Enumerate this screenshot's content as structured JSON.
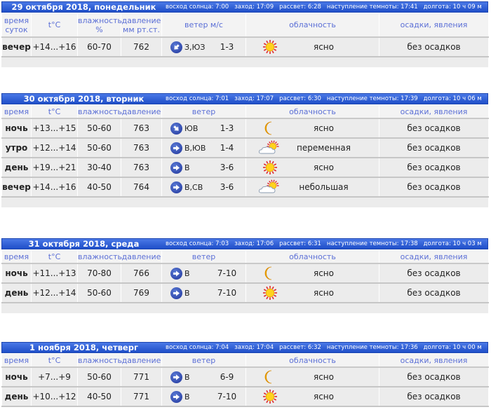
{
  "days": [
    {
      "title": "29 октября 2018, понедельник",
      "info": [
        "восход солнца: 7:00",
        "заход: 17:09",
        "рассвет: 6:28",
        "наступление темноты: 17:41",
        "долгота: 10 ч 09 м"
      ],
      "headers": {
        "time": "время суток",
        "temp": "t°C",
        "humidity": "влажность %",
        "pressure": "давление мм рт.ст.",
        "wind": "ветер м/с",
        "clouds": "облачность",
        "precip": "осадки, явления"
      },
      "rows": [
        {
          "time": "вечер",
          "temp": "+14...+16",
          "humidity": "60-70",
          "pressure": "762",
          "wind_dir": "З,ЮЗ",
          "wind_speed": "1-3",
          "wind_arrow": "sw",
          "sky_icon": "sun-icon",
          "clouds": "ясно",
          "precip": "без осадков"
        }
      ]
    },
    {
      "title": "30 октября 2018, вторник",
      "info": [
        "восход солнца: 7:01",
        "заход: 17:07",
        "рассвет: 6:30",
        "наступление темноты: 17:39",
        "долгота: 10 ч 06 м"
      ],
      "headers": {
        "time": "время",
        "temp": "t°C",
        "humidity": "влажность",
        "pressure": "давление",
        "wind": "ветер",
        "clouds": "облачность",
        "precip": "осадки, явления"
      },
      "rows": [
        {
          "time": "ночь",
          "temp": "+13...+15",
          "humidity": "50-60",
          "pressure": "763",
          "wind_dir": "ЮВ",
          "wind_speed": "1-3",
          "wind_arrow": "se",
          "sky_icon": "moon-icon",
          "clouds": "ясно",
          "precip": "без осадков"
        },
        {
          "time": "утро",
          "temp": "+12...+14",
          "humidity": "50-60",
          "pressure": "763",
          "wind_dir": "В,ЮВ",
          "wind_speed": "1-4",
          "wind_arrow": "e",
          "sky_icon": "partly-cloudy-icon",
          "clouds": "переменная",
          "precip": "без осадков"
        },
        {
          "time": "день",
          "temp": "+19...+21",
          "humidity": "30-40",
          "pressure": "763",
          "wind_dir": "В",
          "wind_speed": "3-6",
          "wind_arrow": "e",
          "sky_icon": "sun-icon",
          "clouds": "ясно",
          "precip": "без осадков"
        },
        {
          "time": "вечер",
          "temp": "+14...+16",
          "humidity": "40-50",
          "pressure": "764",
          "wind_dir": "В,СВ",
          "wind_speed": "3-6",
          "wind_arrow": "e",
          "sky_icon": "partly-cloudy-icon",
          "clouds": "небольшая",
          "precip": "без осадков"
        }
      ]
    },
    {
      "title": "31 октября 2018, среда",
      "info": [
        "восход солнца: 7:03",
        "заход: 17:06",
        "рассвет: 6:31",
        "наступление темноты: 17:38",
        "долгота: 10 ч 03 м"
      ],
      "headers": {
        "time": "время",
        "temp": "t°C",
        "humidity": "влажность",
        "pressure": "давление",
        "wind": "ветер",
        "clouds": "облачность",
        "precip": "осадки, явления"
      },
      "rows": [
        {
          "time": "ночь",
          "temp": "+11...+13",
          "humidity": "70-80",
          "pressure": "766",
          "wind_dir": "В",
          "wind_speed": "7-10",
          "wind_arrow": "e",
          "sky_icon": "moon-icon",
          "clouds": "ясно",
          "precip": "без осадков"
        },
        {
          "time": "день",
          "temp": "+12...+14",
          "humidity": "50-60",
          "pressure": "769",
          "wind_dir": "В",
          "wind_speed": "7-10",
          "wind_arrow": "e",
          "sky_icon": "sun-icon",
          "clouds": "ясно",
          "precip": "без осадков"
        }
      ]
    },
    {
      "title": "1 ноября 2018, четверг",
      "info": [
        "восход солнца: 7:04",
        "заход: 17:04",
        "рассвет: 6:32",
        "наступление темноты: 17:36",
        "долгота: 10 ч 00 м"
      ],
      "headers": {
        "time": "время",
        "temp": "t°C",
        "humidity": "влажность",
        "pressure": "давление",
        "wind": "ветер",
        "clouds": "облачность",
        "precip": "осадки, явления"
      },
      "rows": [
        {
          "time": "ночь",
          "temp": "+7...+9",
          "humidity": "50-60",
          "pressure": "771",
          "wind_dir": "В",
          "wind_speed": "6-9",
          "wind_arrow": "e",
          "sky_icon": "moon-icon",
          "clouds": "ясно",
          "precip": "без осадков"
        },
        {
          "time": "день",
          "temp": "+10...+12",
          "humidity": "40-50",
          "pressure": "771",
          "wind_dir": "В",
          "wind_speed": "7-10",
          "wind_arrow": "e",
          "sky_icon": "sun-icon",
          "clouds": "ясно",
          "precip": "без осадков"
        }
      ]
    }
  ]
}
